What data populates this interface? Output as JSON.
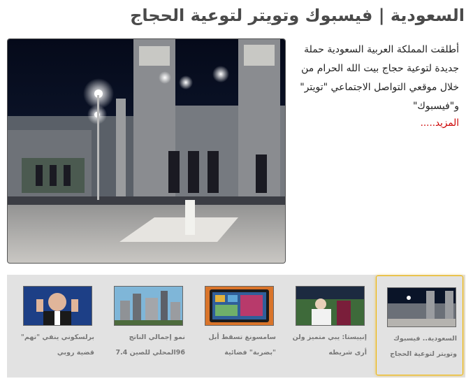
{
  "article": {
    "title": "السعودية | فيسبوك وتويتر لتوعية الحجاج",
    "lead": "أطلقت المملكة العربية السعودية حملة جديدة لتوعية حجاج بيت الله الحرام من خلال موقعي التواصل الاجتماعي \"تويتر\" و\"فيسبوك\"",
    "more_label": "المزيد.....",
    "image_icon": "mosque-photo"
  },
  "related": [
    {
      "caption": "السعودية.. فيسبوك وتويتر لتوعية الحجاج",
      "image_icon": "mosque-thumb",
      "active": true
    },
    {
      "caption": "إنييستا: يبي متميز ولن أرى شريطه",
      "image_icon": "football-thumb",
      "active": false
    },
    {
      "caption": "سامسونغ تسقط أبل \"بضربة\" فضائية",
      "image_icon": "tablet-thumb",
      "active": false
    },
    {
      "caption": "نمو إجمالي الناتج 96المحلي للصين 7.4",
      "image_icon": "city-thumb",
      "active": false
    },
    {
      "caption": "برلسكوني ينفي \"تهم\" قضية روبي",
      "image_icon": "politician-thumb",
      "active": false
    }
  ],
  "colors": {
    "accent": "#f0b400",
    "link": "#cc0000",
    "strip_bg": "#e2e2e2"
  }
}
